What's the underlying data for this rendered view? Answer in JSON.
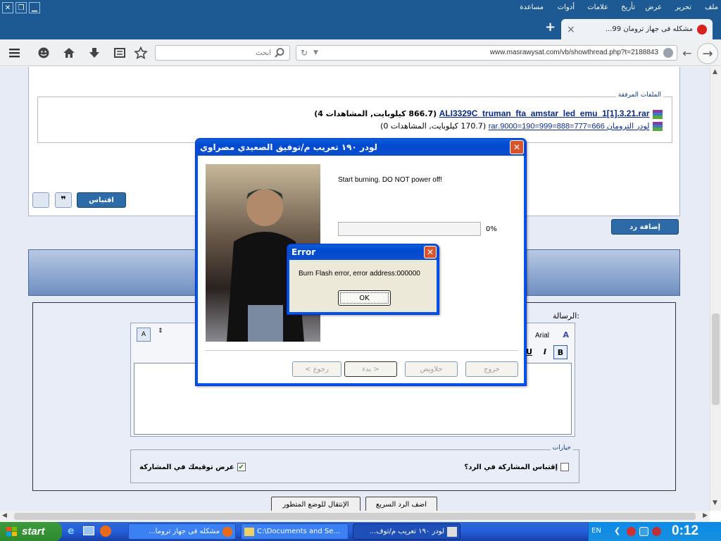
{
  "browser": {
    "menu": [
      "ملف",
      "تحرير",
      "عرض",
      "تأريخ",
      "علامات",
      "أدوات",
      "مساعدة"
    ],
    "tab_title": "مشكله فى جهاز ترومان 99...",
    "new_tab": "+",
    "tab_close": "×",
    "url": "www.masrawysat.com/vb/showthread.php?t=2188843",
    "search_placeholder": "ابحث"
  },
  "attachments": {
    "legend": "الملفات المرفقة",
    "files": [
      {
        "name": "ALI3329C_truman_fta_amstar_led_emu_1[1].3.21.rar",
        "info": "(866.7 كيلوبايت, المشاهدات 4)"
      },
      {
        "name": "لودر الترومان 666=777=888=999=190=9000.rar",
        "info": "(170.7 كيلوبايت, المشاهدات 0)"
      }
    ]
  },
  "post_buttons": {
    "quote": "اقتباس",
    "add_reply": "إضافة رد"
  },
  "reply_form": {
    "message_label": "الرسالة:",
    "font_name": "Arial",
    "options_legend": "خيارات",
    "quote_option": "إقتباس المشاركة في الرد؟",
    "signature_option": "عرض توقيعك في المشاركة",
    "quick_reply_button": "اضف الرد السريع",
    "advanced_button": "الإنتقال للوضع المتطور"
  },
  "loader_dialog": {
    "title": "لودر ١٩٠ تعريب م/توفيق الصعيدي مصراوي",
    "status": "Start burning. DO NOT power off!",
    "progress_percent": 0,
    "progress_label": "0%",
    "buttons": {
      "back": "< رجوع",
      "start": "بدء >",
      "clear": "خلاويص",
      "exit": "خروج"
    }
  },
  "error_dialog": {
    "title": "Error",
    "message": "Burn Flash error, error address:000000",
    "ok": "OK"
  },
  "taskbar": {
    "start": "start",
    "tasks": [
      "مشكله فى جهاز تروما...",
      "C:\\Documents and Se...",
      "لودر ١٩٠ تعريب م/توف..."
    ],
    "lang": "EN",
    "clock": "0:12"
  },
  "colors": {
    "title_blue": "#0055ea",
    "page_blue": "#1d5a94",
    "taskbar": "#245edb",
    "start_green": "#3c9a3c"
  }
}
